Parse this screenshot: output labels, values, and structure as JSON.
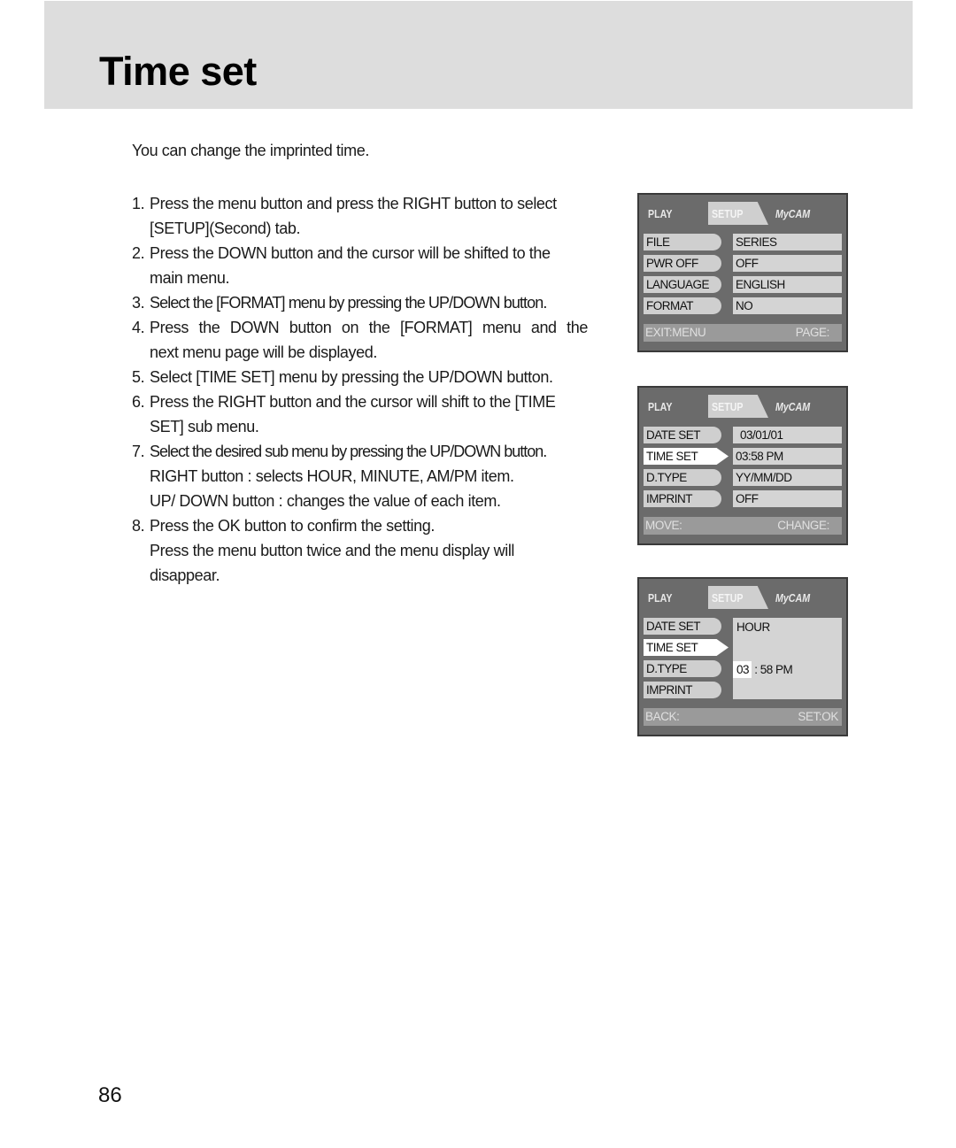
{
  "header": {
    "title": "Time set"
  },
  "intro": "You can change the imprinted time.",
  "steps": [
    {
      "num": "1.",
      "lines": [
        "Press the menu button and press the RIGHT button to select",
        "[SETUP](Second) tab."
      ]
    },
    {
      "num": "2.",
      "lines": [
        "Press the DOWN button and the cursor will be shifted to the",
        "main menu."
      ]
    },
    {
      "num": "3.",
      "lines": [
        "Select the [FORMAT] menu by pressing the UP/DOWN button."
      ]
    },
    {
      "num": "4.",
      "lines": [
        "Press the DOWN button on the [FORMAT] menu and the",
        "next menu page will be displayed."
      ]
    },
    {
      "num": "5.",
      "lines": [
        "Select [TIME SET] menu by pressing the UP/DOWN button."
      ]
    },
    {
      "num": "6.",
      "lines": [
        "Press the RIGHT button and the cursor will shift to the [TIME",
        "SET] sub menu."
      ]
    },
    {
      "num": "7.",
      "lines": [
        "Select the desired sub menu by pressing the UP/DOWN button.",
        "RIGHT button : selects HOUR, MINUTE, AM/PM item.",
        "UP/ DOWN button : changes the value of each item."
      ]
    },
    {
      "num": "8.",
      "lines": [
        "Press the OK button to confirm the setting.",
        "Press the menu button twice and the menu display will",
        "disappear."
      ]
    }
  ],
  "screens": [
    {
      "tabs": [
        "PLAY",
        "SETUP",
        "MyCAM"
      ],
      "active_tab": "SETUP",
      "rows": [
        {
          "label": "FILE",
          "value": "SERIES"
        },
        {
          "label": "PWR OFF",
          "value": "OFF"
        },
        {
          "label": "LANGUAGE",
          "value": "ENGLISH"
        },
        {
          "label": "FORMAT",
          "value": "NO"
        }
      ],
      "footer_left": "EXIT:MENU",
      "footer_right": "PAGE:"
    },
    {
      "tabs": [
        "PLAY",
        "SETUP",
        "MyCAM"
      ],
      "active_tab": "SETUP",
      "selected_row": "TIME SET",
      "rows": [
        {
          "label": "DATE SET",
          "value": "03/01/01"
        },
        {
          "label": "TIME SET",
          "value": "03:58 PM"
        },
        {
          "label": "D.TYPE",
          "value": "YY/MM/DD"
        },
        {
          "label": "IMPRINT",
          "value": "OFF"
        }
      ],
      "footer_left": "MOVE:",
      "footer_right": "CHANGE:"
    },
    {
      "tabs": [
        "PLAY",
        "SETUP",
        "MyCAM"
      ],
      "active_tab": "SETUP",
      "selected_row": "TIME SET",
      "rows": [
        {
          "label": "DATE SET"
        },
        {
          "label": "TIME SET"
        },
        {
          "label": "D.TYPE"
        },
        {
          "label": "IMPRINT"
        }
      ],
      "submenu": {
        "title": "HOUR",
        "hour": "03",
        "rest": " : 58 PM"
      },
      "footer_left": "BACK:",
      "footer_right": "SET:OK"
    }
  ],
  "page_number": "86"
}
